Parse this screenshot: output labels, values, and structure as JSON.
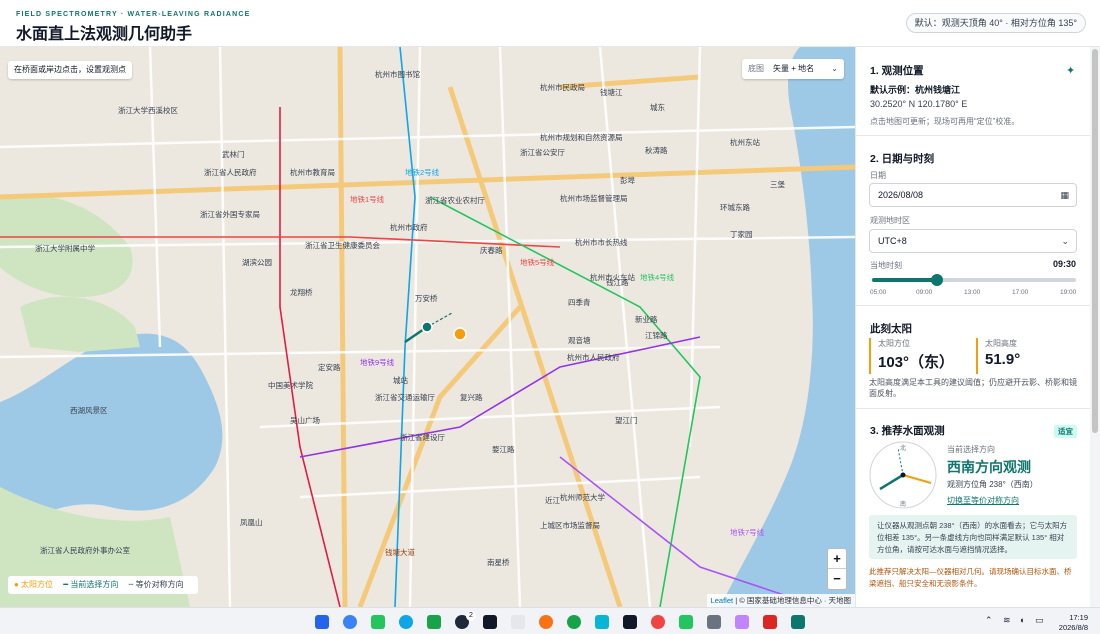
{
  "header": {
    "eyebrow": "FIELD SPECTROMETRY · WATER-LEAVING RADIANCE",
    "title": "水面直上法观测几何助手",
    "default_badge": "默认：观测天顶角 40° · 相对方位角 135°"
  },
  "map": {
    "hint": "在桥面或岸边点击，设置观测点",
    "layer_label": "底图",
    "layer_value": "矢量 + 地名",
    "zoom_in": "+",
    "zoom_out": "−",
    "legend": {
      "sun": "● 太阳方位",
      "current": "━ 当前选择方向",
      "symmetric": "╌ 等价对称方向"
    },
    "attribution_leaflet": "Leaflet",
    "attribution_rest": " | © 国家基础地理信息中心 · 天地图",
    "place_labels": [
      "杭州市图书馆",
      "浙江大学西溪校区",
      "杭州市民政局",
      "武林门",
      "杭州市教育局",
      "浙江省人民政府",
      "杭州市规划和自然资源局",
      "浙江省卫生健康委员会",
      "浙江省外国专家局",
      "浙江大学附属中学",
      "湖滨公园",
      "龙翔桥",
      "万安桥",
      "杭州市政府",
      "庆春路",
      "浙江省农业农村厅",
      "杭州市场监督管理局",
      "浙江省公安厅",
      "杭州市市长热线",
      "钱江路",
      "江锦路",
      "新业路",
      "杭州市人民政府",
      "望江门",
      "城站",
      "定安路",
      "西湖风景区",
      "吴山广场",
      "浙江省交通运输厅",
      "中国美术学院",
      "杭州师范大学",
      "凤凰山",
      "浙江省建设厅",
      "婺江路",
      "复兴路",
      "近江",
      "上城区市场监督局",
      "南星桥",
      "杭州市火车站",
      "浙江省人民政府外事办公室",
      "钱塘江",
      "三堡",
      "环城东路",
      "丁家园",
      "观音塘",
      "四季青",
      "秋涛路",
      "彭埠",
      "城东",
      "杭州东站"
    ],
    "metro_labels": [
      "地铁1号线",
      "地铁2号线",
      "地铁4号线",
      "地铁5号线",
      "地铁7号线",
      "地铁9号线"
    ],
    "road_label": "钱塘大道"
  },
  "panel": {
    "s1_title": "1. 观测位置",
    "s1_default": "默认示例：杭州钱塘江",
    "s1_coords": "30.2520° N   120.1780° E",
    "s1_hint": "点击地图可更新；现场可再用“定位”校准。",
    "s2_title": "2. 日期与时刻",
    "date_label": "日期",
    "date_value": "2026/08/08",
    "tz_label": "观测地时区",
    "tz_value": "UTC+8",
    "time_label": "当地时刻",
    "time_value": "09:30",
    "time_fraction": 0.32,
    "ticks": [
      "05:00",
      "09:00",
      "13:00",
      "17:00",
      "19:00"
    ],
    "s3_title": "此刻太阳",
    "sun_az_label": "太阳方位",
    "sun_az_value": "103°（东）",
    "sun_el_label": "太阳高度",
    "sun_el_value": "51.9°",
    "sun_note": "太阳高度满足本工具的建议阈值；仍应避开云影、桥影和镜面反射。",
    "s4_title": "3. 推荐水面观测",
    "s4_tag": "适宜",
    "rec_caption": "当前选择方向",
    "rec_title": "西南方向观测",
    "rec_az": "观测方位角 238°（西南）",
    "rec_link": "切换至等价对称方向",
    "compass_n": "北",
    "compass_s": "南",
    "note": "让仪器从观测点朝 238°（西南）的水面看去；它与太阳方位相差 135°。另一条虚线方向也同样满足默认 135° 相对方位角，请按可达水面与遮挡情况选择。",
    "footnote": "此推荐只解决太阳—仪器相对几何。请现场确认目标水面、桥梁遮挡、船只安全和无浪影条件。"
  },
  "taskbar": {
    "time": "17:19",
    "date": "2026/8/8",
    "badge": "2"
  },
  "colors": {
    "accent": "#0f766e",
    "sun": "#f59e0b",
    "water": "#9ec9e6",
    "park": "#cfe5c2"
  }
}
